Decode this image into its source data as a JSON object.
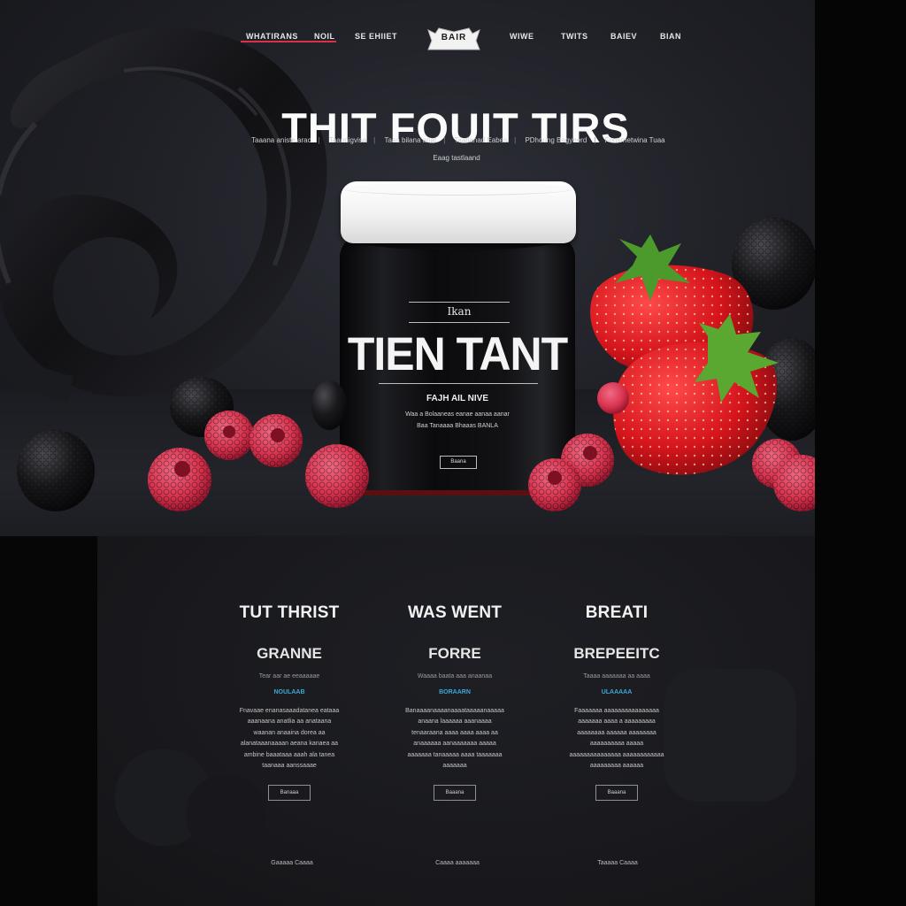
{
  "nav": {
    "items": [
      "WHATIRANS",
      "NOIL",
      "SE EHIIET",
      "WIWE",
      "TWITS",
      "BAIEV",
      "BIAN"
    ],
    "logo_text": "BAIR"
  },
  "hero": {
    "title": "THIT FOUIT TIRS",
    "sub_links": [
      "Taaana aniste arac",
      "Taannigvisa",
      "Taaa bilana anat",
      "Taatlanad Eabes",
      "PDhoung Bagyeerd",
      "Fonsrnetwina Tuaa"
    ],
    "sub_line2": "Eaag tastlaand"
  },
  "jar": {
    "brand": "Ikan",
    "title": "TIEN TANT",
    "subtitle": "FAJH AIL NIVE",
    "desc_1": "Waa a Bolaaneas eanae aanaa aanar",
    "desc_2": "Baa Tanaaaa Bhaaas BANLA",
    "button": "Baana"
  },
  "features": [
    {
      "heading": "TUT THRIST",
      "sub": "GRANNE",
      "tag": "Tear aar ae eeaaaaae",
      "link": "NOULAAB",
      "text": "Fnavaae enanasaaadatanea eataaa aaanaana anatlia aa anataana waanan anaaina dorea aa alanataaanaaaan aeana kanaea aa ambine baaataaa aaah ala tanea taanaaa aanssaaae",
      "button": "Banaaa",
      "footer": "Gaaaaa Caaaa"
    },
    {
      "heading": "WAS WENT",
      "sub": "FORRE",
      "tag": "Waaaa baata aaa anaanaa",
      "link": "BORAARN",
      "text": "Banaaaanaaaanaaaataaaaanaaaaa anaana laaaaaa aaanaaaa tenaaraana aaaa aaaa aaaa aa anaaaaaa aanaaaaaaa aaaaa aaaaaaa tanaaaaa aaaa taaaaaaa aaaaaaa",
      "button": "Baaana",
      "footer": "Caaaa aaaaaaa"
    },
    {
      "heading": "BREATI",
      "sub": "BREPEEITC",
      "tag": "Taaaa aaaaaaa aa aaaa",
      "link": "ULAAAAA",
      "text": "Faaaaaaa aaaaaaaaaaaaaaaa aaaaaaa aaaa a aaaaaaaaa aaaaaaaa aaaaaa aaaaaaaa aaaaaaaaaa aaaaa aaaaaaaaaaaaaaa aaaaaaaaaaaa aaaaaaaaa aaaaaa",
      "button": "Baaana",
      "footer": "Taaaaa Caaaa"
    }
  ],
  "colors": {
    "accent": "#d8324a",
    "link": "#3ea7d6",
    "background": "#1e1f25",
    "strawberry": "#c8141c",
    "raspberry": "#d9344f"
  }
}
